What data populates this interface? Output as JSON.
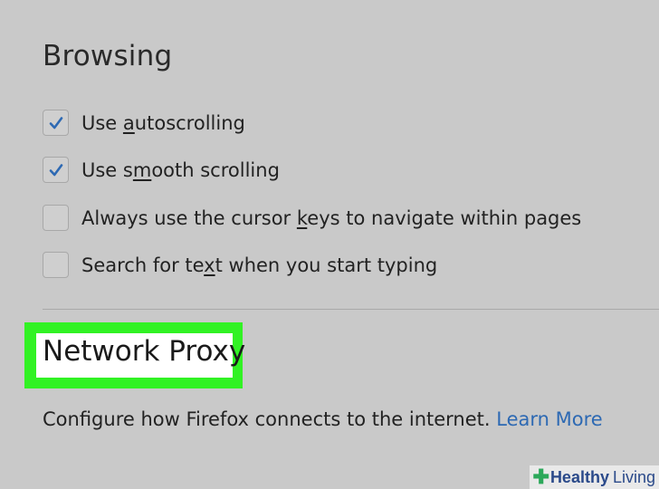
{
  "browsing": {
    "title": "Browsing",
    "options": [
      {
        "pre": "Use ",
        "accel": "a",
        "post": "utoscrolling",
        "checked": true
      },
      {
        "pre": "Use s",
        "accel": "m",
        "post": "ooth scrolling",
        "checked": true
      },
      {
        "pre": "Always use the cursor ",
        "accel": "k",
        "post": "eys to navigate within pages",
        "checked": false
      },
      {
        "pre": "Search for te",
        "accel": "x",
        "post": "t when you start typing",
        "checked": false
      }
    ]
  },
  "network_proxy": {
    "title": "Network Proxy",
    "description": "Configure how Firefox connects to the internet.",
    "learn_more": "Learn More",
    "highlight_color": "#31f224"
  },
  "watermark": {
    "brand_bold": "Healthy",
    "brand_regular": "Living"
  },
  "colors": {
    "background": "#c9c9c9",
    "checkmark": "#2d69b3",
    "link": "#2d69b3"
  },
  "icons": [
    "checkmark-icon",
    "plus-logo-icon"
  ]
}
